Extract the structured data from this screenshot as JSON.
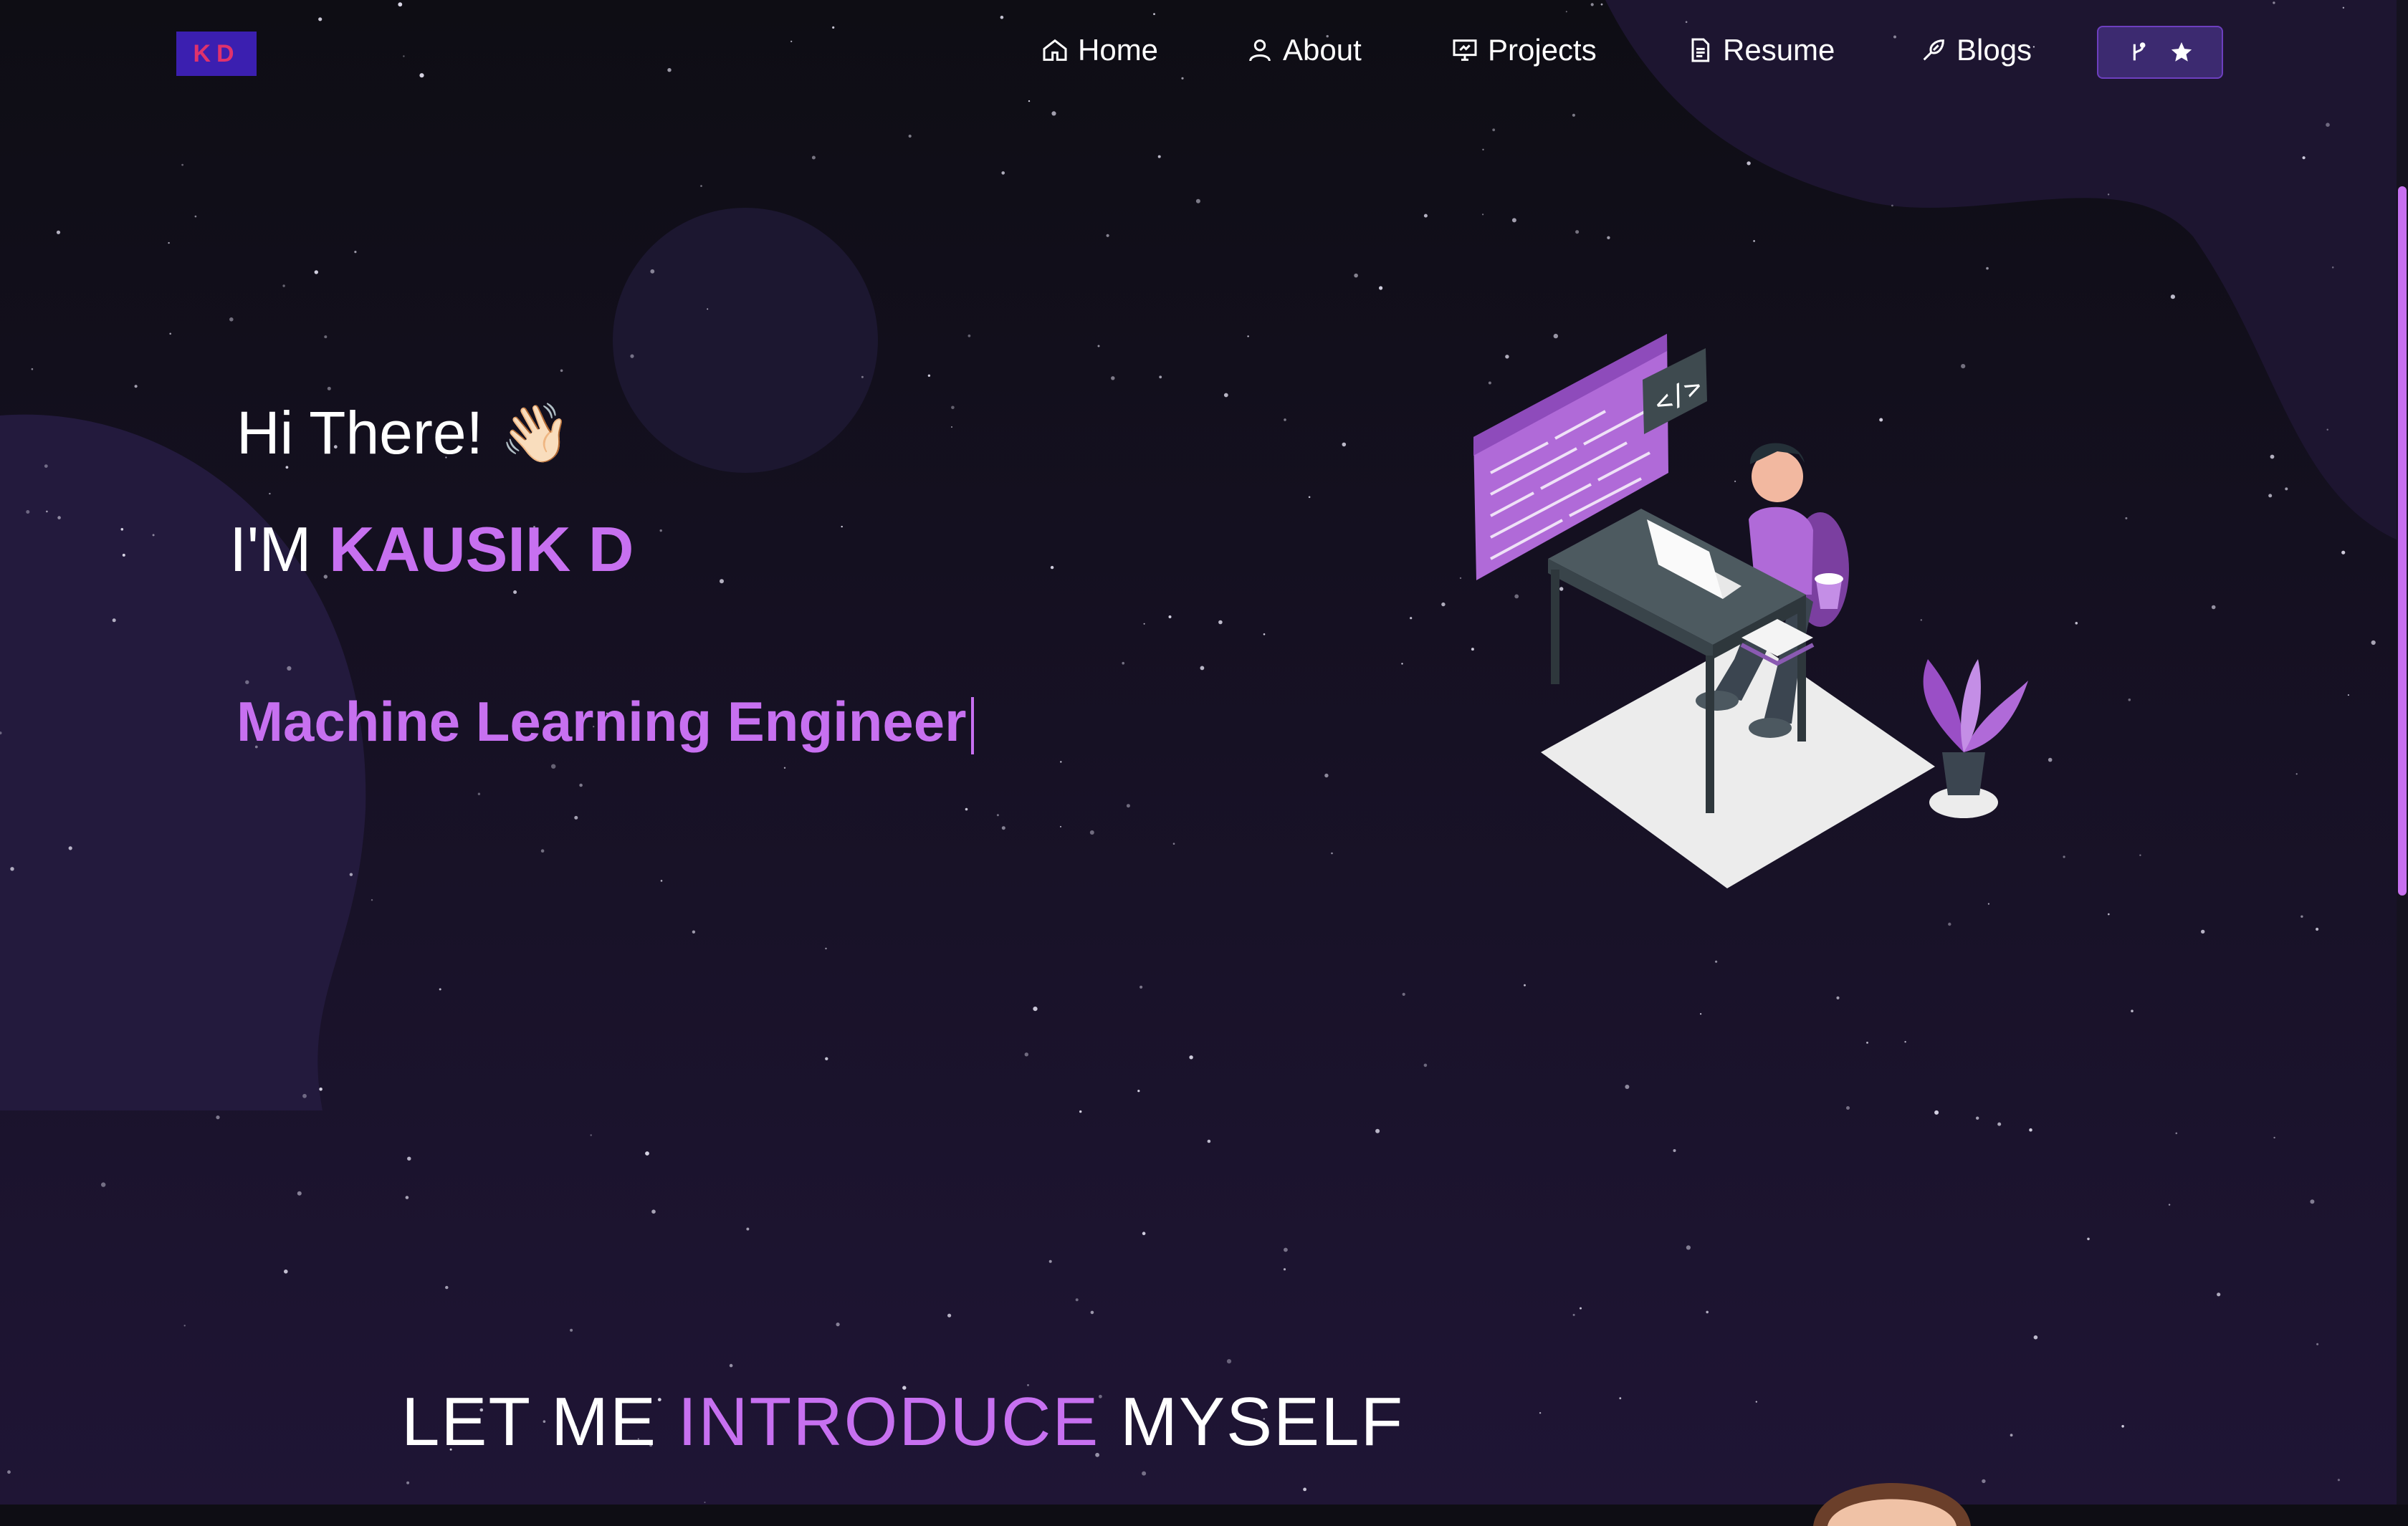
{
  "nav": {
    "logo": "KD",
    "items": [
      {
        "label": "Home",
        "icon": "home-icon"
      },
      {
        "label": "About",
        "icon": "user-icon"
      },
      {
        "label": "Projects",
        "icon": "presentation-icon"
      },
      {
        "label": "Resume",
        "icon": "document-icon"
      },
      {
        "label": "Blogs",
        "icon": "pen-icon"
      }
    ],
    "github_button": {
      "icons": [
        "fork-icon",
        "star-icon"
      ]
    }
  },
  "hero": {
    "greeting": "Hi There!",
    "wave": "👋🏻",
    "im_prefix": "I'M",
    "name": "KAUSIK D",
    "role": "Machine Learning Engineer"
  },
  "intro": {
    "part1": "LET ME",
    "highlight": "INTRODUCE",
    "part2": "MYSELF"
  },
  "colors": {
    "accent": "#c770f0",
    "background": "#0e0d14",
    "blob": "#221a3a"
  }
}
